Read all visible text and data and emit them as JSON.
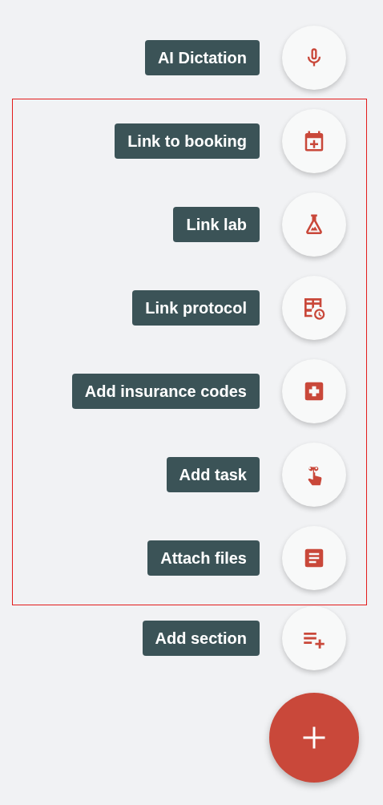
{
  "groups": [
    {
      "highlighted": false,
      "actions": [
        {
          "label": "AI Dictation",
          "kind": "mic"
        }
      ]
    },
    {
      "highlighted": true,
      "actions": [
        {
          "label": "Link to booking",
          "kind": "calendar"
        },
        {
          "label": "Link lab",
          "kind": "flask"
        },
        {
          "label": "Link protocol",
          "kind": "schedule"
        },
        {
          "label": "Add insurance codes",
          "kind": "medical"
        },
        {
          "label": "Add task",
          "kind": "task"
        },
        {
          "label": "Attach files",
          "kind": "file"
        }
      ]
    },
    {
      "highlighted": false,
      "actions": [
        {
          "label": "Add section",
          "kind": "playlist"
        }
      ]
    }
  ],
  "main_button": {
    "kind": "plus"
  }
}
